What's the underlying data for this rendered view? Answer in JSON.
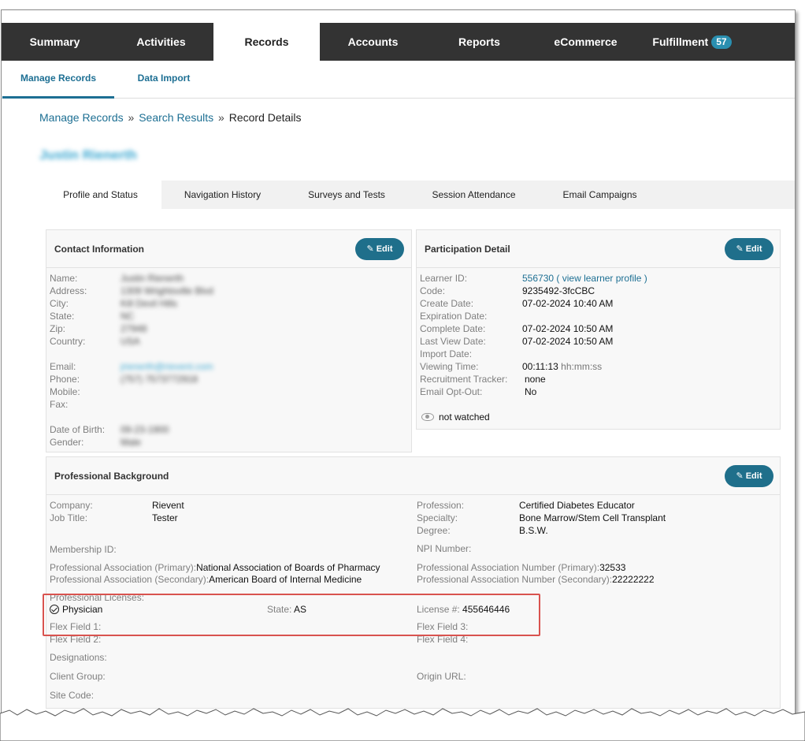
{
  "topnav": {
    "tabs": [
      {
        "label": "Summary"
      },
      {
        "label": "Activities"
      },
      {
        "label": "Records"
      },
      {
        "label": "Accounts"
      },
      {
        "label": "Reports"
      },
      {
        "label": "eCommerce"
      },
      {
        "label": "Fulfillment",
        "badge": "57"
      }
    ],
    "active": "Records"
  },
  "subnav": {
    "items": [
      {
        "label": "Manage Records"
      },
      {
        "label": "Data Import"
      }
    ],
    "active": "Manage Records"
  },
  "breadcrumb": {
    "items": [
      "Manage Records",
      "Search Results",
      "Record Details"
    ],
    "separator": "»"
  },
  "record": {
    "name": "Justin Rienerth"
  },
  "record_tabs": [
    {
      "label": "Profile and Status"
    },
    {
      "label": "Navigation History"
    },
    {
      "label": "Surveys and Tests"
    },
    {
      "label": "Session Attendance"
    },
    {
      "label": "Email Campaigns"
    }
  ],
  "edit_label": "Edit",
  "contact": {
    "title": "Contact Information",
    "name_label": "Name:",
    "name": "Justin Rienerth",
    "address_label": "Address:",
    "address": "1309 Wrightsville Blvd",
    "city_label": "City:",
    "city": "Kill Devil Hills",
    "state_label": "State:",
    "state": "NC",
    "zip_label": "Zip:",
    "zip": "27948",
    "country_label": "Country:",
    "country": "USA",
    "email_label": "Email:",
    "email": "jrienerth@rievent.com",
    "phone_label": "Phone:",
    "phone": "(757) 7573772918",
    "mobile_label": "Mobile:",
    "fax_label": "Fax:",
    "dob_label": "Date of Birth:",
    "dob": "09-23-1900",
    "gender_label": "Gender:",
    "gender": "Male"
  },
  "participation": {
    "title": "Participation Detail",
    "learner_id_label": "Learner ID:",
    "learner_id": "556730",
    "view_profile": "view learner profile",
    "paren_open": "(",
    "paren_close": ")",
    "code_label": "Code:",
    "code": "9235492-3fcCBC",
    "create_date_label": "Create Date:",
    "create_date": "07-02-2024 10:40 AM",
    "expiration_date_label": "Expiration Date:",
    "complete_date_label": "Complete Date:",
    "complete_date": "07-02-2024 10:50 AM",
    "last_view_date_label": "Last View Date:",
    "last_view_date": "07-02-2024 10:50 AM",
    "import_date_label": "Import Date:",
    "viewing_time_label": "Viewing Time:",
    "viewing_time": "00:11:13",
    "viewing_time_unit": "hh:mm:ss",
    "recruitment_tracker_label": "Recruitment Tracker:",
    "recruitment_tracker": "none",
    "email_opt_out_label": "Email Opt-Out:",
    "email_opt_out": "No",
    "watch_status": "not watched"
  },
  "professional": {
    "title": "Professional Background",
    "company_label": "Company:",
    "company": "Rievent",
    "job_title_label": "Job Title:",
    "job_title": "Tester",
    "profession_label": "Profession:",
    "profession": "Certified Diabetes Educator",
    "specialty_label": "Specialty:",
    "specialty": "Bone Marrow/Stem Cell Transplant",
    "degree_label": "Degree:",
    "degree": "B.S.W.",
    "membership_id_label": "Membership ID:",
    "npi_label": "NPI Number:",
    "assoc_primary_label": "Professional Association (Primary):",
    "assoc_primary": "National Association of Boards of Pharmacy",
    "assoc_secondary_label": "Professional Association (Secondary):",
    "assoc_secondary": "American Board of Internal Medicine",
    "assoc_num_primary_label": "Professional Association Number (Primary):",
    "assoc_num_primary": "32533",
    "assoc_num_secondary_label": "Professional Association Number (Secondary):",
    "assoc_num_secondary": "22222222",
    "licenses_label": "Professional Licenses:",
    "license_type": "Physician",
    "license_state_label": "State:",
    "license_state": "AS",
    "license_number_label": "License #:",
    "license_number": "455646446",
    "flex1_label": "Flex Field 1:",
    "flex2_label": "Flex Field 2:",
    "flex3_label": "Flex Field 3:",
    "flex4_label": "Flex Field 4:",
    "designations_label": "Designations:",
    "client_group_label": "Client Group:",
    "origin_url_label": "Origin URL:",
    "site_code_label": "Site Code:"
  }
}
